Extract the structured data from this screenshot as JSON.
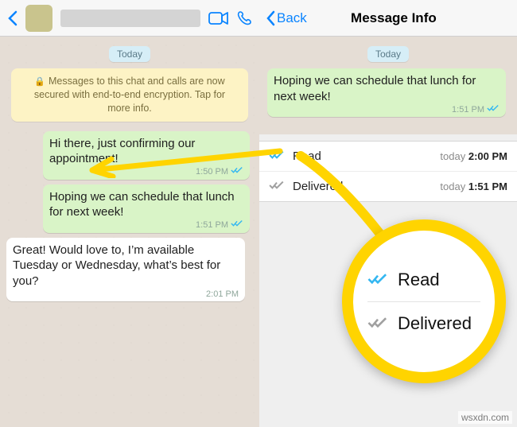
{
  "left": {
    "day": "Today",
    "system": "Messages to this chat and calls are now secured with end-to-end encryption. Tap for more info.",
    "msgs": [
      {
        "dir": "out",
        "text": "Hi there, just confirming our appointment!",
        "time": "1:50 PM"
      },
      {
        "dir": "out",
        "text": "Hoping we can schedule that lunch for next week!",
        "time": "1:51 PM"
      },
      {
        "dir": "in",
        "text": "Great!  Would love to, I’m available Tuesday or Wednesday, what’s best for you?",
        "time": "2:01 PM"
      }
    ]
  },
  "right": {
    "back": "Back",
    "title": "Message Info",
    "day": "Today",
    "msg": {
      "text": "Hoping we can schedule that lunch for next week!",
      "time": "1:51 PM"
    },
    "rows": [
      {
        "kind": "read",
        "label": "Read",
        "time_prefix": "today",
        "time": "2:00 PM"
      },
      {
        "kind": "delivered",
        "label": "Delivered",
        "time_prefix": "today",
        "time": "1:51 PM"
      }
    ]
  },
  "zoom": {
    "rows": [
      {
        "kind": "read",
        "label": "Read"
      },
      {
        "kind": "delivered",
        "label": "Delivered"
      }
    ]
  },
  "watermark": "wsxdn.com"
}
